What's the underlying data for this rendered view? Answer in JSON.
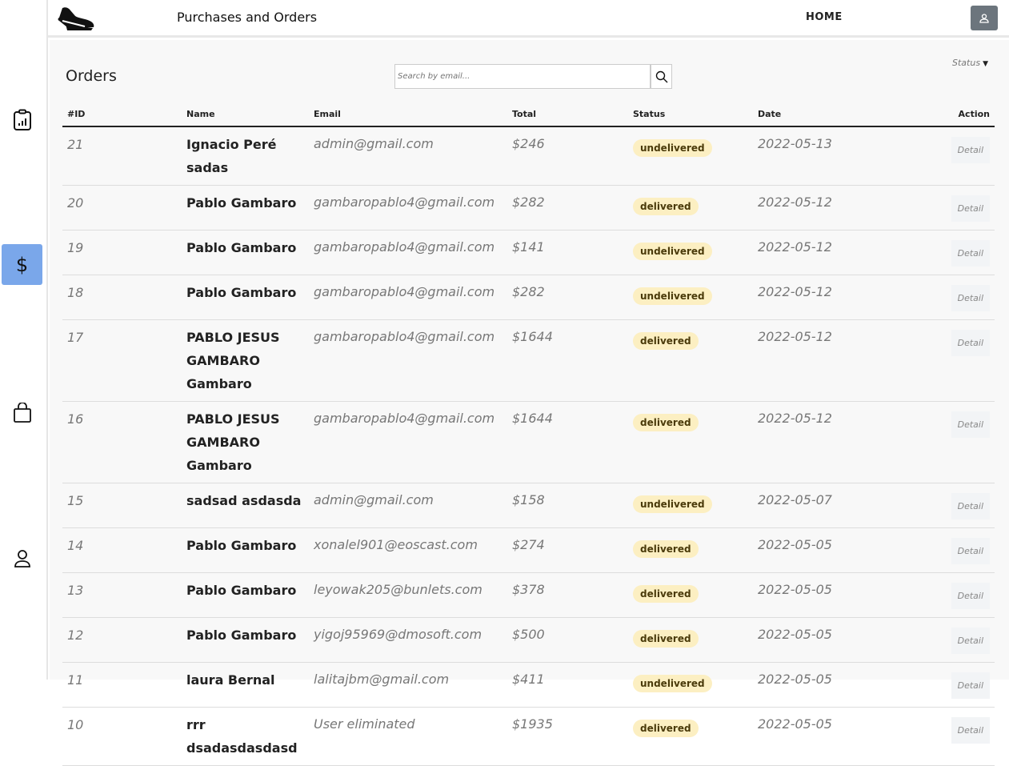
{
  "header": {
    "title": "Purchases and Orders",
    "nav_home": "HOME"
  },
  "sidebar": {
    "items": [
      {
        "icon": "clipboard-chart-icon"
      },
      {
        "icon": "dollar-icon",
        "label": "$",
        "active": true
      },
      {
        "icon": "shopping-bag-icon"
      },
      {
        "icon": "user-icon"
      }
    ]
  },
  "main": {
    "heading": "Orders",
    "search_placeholder": "Search by email...",
    "status_filter": "Status",
    "accent": "#7aa7ea",
    "badge_color": "#fcefc2"
  },
  "table": {
    "columns": [
      "#ID",
      "Name",
      "Email",
      "Total",
      "Status",
      "Date",
      "Action"
    ],
    "rows": [
      {
        "id": "21",
        "name": "Ignacio Peré sadas",
        "email": "admin@gmail.com",
        "total": "$246",
        "status": "undelivered",
        "date": "2022-05-13",
        "action": "Detail"
      },
      {
        "id": "20",
        "name": "Pablo Gambaro",
        "email": "gambaropablo4@gmail.com",
        "total": "$282",
        "status": "delivered",
        "date": "2022-05-12",
        "action": "Detail"
      },
      {
        "id": "19",
        "name": "Pablo Gambaro",
        "email": "gambaropablo4@gmail.com",
        "total": "$141",
        "status": "undelivered",
        "date": "2022-05-12",
        "action": "Detail"
      },
      {
        "id": "18",
        "name": "Pablo Gambaro",
        "email": "gambaropablo4@gmail.com",
        "total": "$282",
        "status": "undelivered",
        "date": "2022-05-12",
        "action": "Detail"
      },
      {
        "id": "17",
        "name": "PABLO JESUS GAMBARO Gambaro",
        "email": "gambaropablo4@gmail.com",
        "total": "$1644",
        "status": "delivered",
        "date": "2022-05-12",
        "action": "Detail"
      },
      {
        "id": "16",
        "name": "PABLO JESUS GAMBARO Gambaro",
        "email": "gambaropablo4@gmail.com",
        "total": "$1644",
        "status": "delivered",
        "date": "2022-05-12",
        "action": "Detail"
      },
      {
        "id": "15",
        "name": "sadsad asdasda",
        "email": "admin@gmail.com",
        "total": "$158",
        "status": "undelivered",
        "date": "2022-05-07",
        "action": "Detail"
      },
      {
        "id": "14",
        "name": "Pablo Gambaro",
        "email": "xonalel901@eoscast.com",
        "total": "$274",
        "status": "delivered",
        "date": "2022-05-05",
        "action": "Detail"
      },
      {
        "id": "13",
        "name": "Pablo Gambaro",
        "email": "leyowak205@bunlets.com",
        "total": "$378",
        "status": "delivered",
        "date": "2022-05-05",
        "action": "Detail"
      },
      {
        "id": "12",
        "name": "Pablo Gambaro",
        "email": "yigoj95969@dmosoft.com",
        "total": "$500",
        "status": "delivered",
        "date": "2022-05-05",
        "action": "Detail"
      },
      {
        "id": "11",
        "name": "laura Bernal",
        "email": "lalitajbm@gmail.com",
        "total": "$411",
        "status": "undelivered",
        "date": "2022-05-05",
        "action": "Detail"
      },
      {
        "id": "10",
        "name": "rrr dsadasdasdasd",
        "email": "User eliminated",
        "total": "$1935",
        "status": "delivered",
        "date": "2022-05-05",
        "action": "Detail"
      }
    ]
  }
}
